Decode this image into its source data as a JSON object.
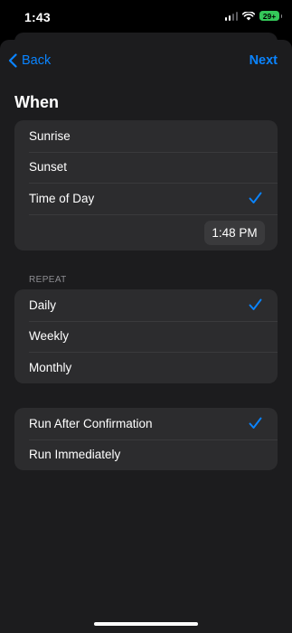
{
  "status_bar": {
    "time": "1:43",
    "battery": "29+"
  },
  "nav": {
    "back_label": "Back",
    "next_label": "Next"
  },
  "title": "When",
  "when_options": [
    {
      "label": "Sunrise",
      "selected": false
    },
    {
      "label": "Sunset",
      "selected": false
    },
    {
      "label": "Time of Day",
      "selected": true
    }
  ],
  "time_value": "1:48 PM",
  "repeat": {
    "header": "REPEAT",
    "options": [
      {
        "label": "Daily",
        "selected": true
      },
      {
        "label": "Weekly",
        "selected": false
      },
      {
        "label": "Monthly",
        "selected": false
      }
    ]
  },
  "run_mode": {
    "options": [
      {
        "label": "Run After Confirmation",
        "selected": true
      },
      {
        "label": "Run Immediately",
        "selected": false
      }
    ]
  },
  "colors": {
    "accent": "#0a84ff",
    "sheet_background": "#1c1c1e",
    "group_background": "#2c2c2e",
    "battery": "#34c759"
  },
  "icons": {
    "back": "chevron-left-icon",
    "check": "checkmark-icon",
    "signal": "cellular-signal-icon",
    "wifi": "wifi-icon",
    "battery": "battery-icon"
  }
}
